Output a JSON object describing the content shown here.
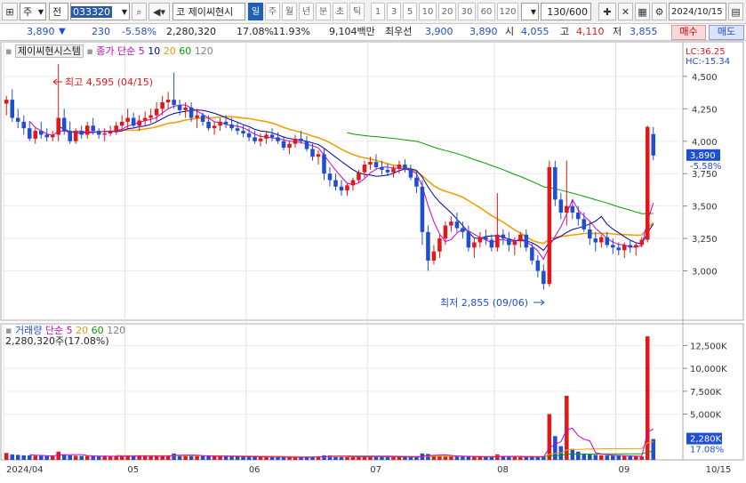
{
  "toolbar": {
    "market": "주",
    "market_type": "전",
    "code": "033320",
    "stock_name_prefix": "코",
    "stock_name": "제이씨현시",
    "periods": [
      "일",
      "주",
      "월",
      "년",
      "분",
      "초",
      "틱"
    ],
    "active_period": "일",
    "numbers": [
      "1",
      "3",
      "5",
      "10",
      "20",
      "30",
      "60",
      "120"
    ],
    "count": "130/600",
    "date": "2024/10/15",
    "icons": [
      "menu-icon",
      "dropdown-icon",
      "search-icon",
      "speaker-icon",
      "expand-icon",
      "collapse-icon",
      "grid-icon",
      "edit-icon",
      "expand-icon",
      "gear-icon"
    ]
  },
  "quote": {
    "price": "3,890",
    "direction": "▼",
    "change": "230",
    "change_pct": "-5.58%",
    "volume": "2,280,320",
    "vol_pct": "17.08%",
    "turnover": "11.93%",
    "amount": "9,104백만",
    "ask_label": "최우선",
    "ask": "3,900",
    "bid": "3,890",
    "open_label": "시",
    "open": "4,055",
    "high_label": "고",
    "high": "4,110",
    "low_label": "저",
    "low": "3,855",
    "buy_label": "매수",
    "sell_label": "매도"
  },
  "price_panel": {
    "title": "제이씨현시스템",
    "ma_label": "종가 단순",
    "ma_periods": [
      "5",
      "10",
      "20",
      "60",
      "120"
    ],
    "lc": "LC:36.25",
    "hc": "HC:-15.34",
    "high_annotation": "최고 4,595 (04/15)",
    "low_annotation": "최저 2,855 (09/06)",
    "current_price_tag": "3,890",
    "current_pct_tag": "-5.58%",
    "y_ticks": [
      "4,500",
      "4,250",
      "4,000",
      "3,750",
      "3,500",
      "3,250",
      "3,000"
    ]
  },
  "volume_panel": {
    "title": "거래량",
    "ma_label": "단순",
    "ma_periods": [
      "5",
      "20",
      "60",
      "120"
    ],
    "value": "2,280,320주(17.08%)",
    "current_tag": "2,280K",
    "current_pct_tag": "17.08%",
    "y_ticks": [
      "12,500K",
      "10,000K",
      "7,500K",
      "5,000K"
    ]
  },
  "x_axis": {
    "labels": [
      "2024/04",
      "05",
      "06",
      "07",
      "08",
      "09",
      "10",
      "10/15"
    ]
  },
  "colors": {
    "up": "#e01818",
    "down": "#1f4fd0",
    "ma5": "#cc00cc",
    "ma10": "#0000aa",
    "ma20": "#f0a000",
    "ma60": "#00a000",
    "ma120": "#808080"
  },
  "chart_data": {
    "type": "candlestick",
    "start": "2024/04/01",
    "ohlc": [
      [
        4290,
        4350,
        4200,
        4320
      ],
      [
        4320,
        4400,
        4150,
        4180
      ],
      [
        4180,
        4250,
        4100,
        4150
      ],
      [
        4150,
        4200,
        4050,
        4100
      ],
      [
        4100,
        4150,
        4000,
        4020
      ],
      [
        4020,
        4100,
        3980,
        4080
      ],
      [
        4080,
        4150,
        4020,
        4050
      ],
      [
        4050,
        4100,
        4000,
        4030
      ],
      [
        4030,
        4080,
        4000,
        4050
      ],
      [
        4050,
        4595,
        4000,
        4180
      ],
      [
        4180,
        4250,
        4050,
        4080
      ],
      [
        4080,
        4150,
        3980,
        4000
      ],
      [
        4000,
        4100,
        3980,
        4080
      ],
      [
        4080,
        4120,
        4020,
        4050
      ],
      [
        4050,
        4150,
        4020,
        4120
      ],
      [
        4120,
        4180,
        4050,
        4080
      ],
      [
        4080,
        4100,
        4020,
        4050
      ],
      [
        4050,
        4100,
        4000,
        4060
      ],
      [
        4060,
        4120,
        4040,
        4080
      ],
      [
        4080,
        4150,
        4050,
        4120
      ],
      [
        4120,
        4200,
        4080,
        4150
      ],
      [
        4150,
        4250,
        4100,
        4180
      ],
      [
        4180,
        4220,
        4100,
        4120
      ],
      [
        4120,
        4200,
        4080,
        4160
      ],
      [
        4160,
        4230,
        4120,
        4180
      ],
      [
        4180,
        4250,
        4140,
        4200
      ],
      [
        4200,
        4300,
        4150,
        4250
      ],
      [
        4250,
        4350,
        4200,
        4300
      ],
      [
        4300,
        4380,
        4250,
        4320
      ],
      [
        4320,
        4530,
        4250,
        4280
      ],
      [
        4280,
        4320,
        4200,
        4240
      ],
      [
        4240,
        4300,
        4180,
        4260
      ],
      [
        4260,
        4300,
        4150,
        4180
      ],
      [
        4180,
        4250,
        4100,
        4200
      ],
      [
        4200,
        4220,
        4120,
        4150
      ],
      [
        4150,
        4200,
        4080,
        4100
      ],
      [
        4100,
        4150,
        4050,
        4120
      ],
      [
        4120,
        4180,
        4080,
        4150
      ],
      [
        4150,
        4200,
        4100,
        4130
      ],
      [
        4130,
        4180,
        4080,
        4100
      ],
      [
        4100,
        4150,
        4050,
        4080
      ],
      [
        4080,
        4130,
        4030,
        4060
      ],
      [
        4060,
        4100,
        4000,
        4030
      ],
      [
        4030,
        4080,
        3980,
        4000
      ],
      [
        4000,
        4060,
        3960,
        4020
      ],
      [
        4020,
        4080,
        3980,
        4050
      ],
      [
        4050,
        4100,
        4000,
        4030
      ],
      [
        4030,
        4070,
        3980,
        4000
      ],
      [
        4000,
        4040,
        3930,
        3950
      ],
      [
        3950,
        4000,
        3900,
        3980
      ],
      [
        3980,
        4050,
        3950,
        4020
      ],
      [
        4020,
        4080,
        3980,
        4000
      ],
      [
        4000,
        4040,
        3920,
        3940
      ],
      [
        3940,
        3980,
        3850,
        3880
      ],
      [
        3880,
        3930,
        3820,
        3900
      ],
      [
        3900,
        3950,
        3700,
        3750
      ],
      [
        3750,
        3800,
        3650,
        3700
      ],
      [
        3700,
        3750,
        3620,
        3650
      ],
      [
        3650,
        3700,
        3580,
        3620
      ],
      [
        3620,
        3680,
        3580,
        3660
      ],
      [
        3660,
        3720,
        3620,
        3700
      ],
      [
        3700,
        3780,
        3680,
        3760
      ],
      [
        3760,
        3850,
        3720,
        3820
      ],
      [
        3820,
        3880,
        3780,
        3840
      ],
      [
        3840,
        3900,
        3780,
        3800
      ],
      [
        3800,
        3850,
        3740,
        3780
      ],
      [
        3780,
        3830,
        3730,
        3760
      ],
      [
        3760,
        3810,
        3720,
        3790
      ],
      [
        3790,
        3850,
        3750,
        3820
      ],
      [
        3820,
        3860,
        3760,
        3780
      ],
      [
        3780,
        3820,
        3700,
        3720
      ],
      [
        3720,
        3780,
        3600,
        3650
      ],
      [
        3650,
        3700,
        3200,
        3300
      ],
      [
        3300,
        3350,
        3000,
        3080
      ],
      [
        3080,
        3200,
        3050,
        3150
      ],
      [
        3150,
        3280,
        3100,
        3250
      ],
      [
        3250,
        3380,
        3200,
        3350
      ],
      [
        3350,
        3420,
        3300,
        3380
      ],
      [
        3380,
        3450,
        3300,
        3330
      ],
      [
        3330,
        3380,
        3250,
        3300
      ],
      [
        3300,
        3350,
        3150,
        3180
      ],
      [
        3180,
        3250,
        3100,
        3220
      ],
      [
        3220,
        3300,
        3180,
        3260
      ],
      [
        3260,
        3320,
        3200,
        3240
      ],
      [
        3240,
        3280,
        3150,
        3180
      ],
      [
        3180,
        3600,
        3150,
        3280
      ],
      [
        3280,
        3320,
        3200,
        3250
      ],
      [
        3250,
        3300,
        3150,
        3200
      ],
      [
        3200,
        3260,
        3120,
        3230
      ],
      [
        3230,
        3300,
        3180,
        3280
      ],
      [
        3280,
        3320,
        3150,
        3180
      ],
      [
        3180,
        3220,
        3050,
        3080
      ],
      [
        3080,
        3120,
        2950,
        3000
      ],
      [
        3000,
        3050,
        2855,
        2900
      ],
      [
        2900,
        3850,
        2880,
        3800
      ],
      [
        3800,
        3850,
        3500,
        3550
      ],
      [
        3550,
        3600,
        3400,
        3450
      ],
      [
        3450,
        3850,
        3350,
        3500
      ],
      [
        3500,
        3550,
        3400,
        3450
      ],
      [
        3450,
        3500,
        3350,
        3400
      ],
      [
        3400,
        3450,
        3300,
        3320
      ],
      [
        3320,
        3380,
        3200,
        3250
      ],
      [
        3250,
        3300,
        3150,
        3220
      ],
      [
        3220,
        3280,
        3180,
        3260
      ],
      [
        3260,
        3300,
        3180,
        3200
      ],
      [
        3200,
        3250,
        3130,
        3180
      ],
      [
        3180,
        3220,
        3120,
        3160
      ],
      [
        3160,
        3220,
        3100,
        3200
      ],
      [
        3200,
        3240,
        3140,
        3180
      ],
      [
        3180,
        3220,
        3120,
        3200
      ],
      [
        3200,
        3260,
        3180,
        3240
      ],
      [
        3240,
        4120,
        3220,
        4110
      ],
      [
        4055,
        4110,
        3855,
        3890
      ]
    ],
    "volume_k": [
      750,
      600,
      550,
      500,
      480,
      450,
      430,
      420,
      410,
      900,
      600,
      500,
      450,
      430,
      420,
      410,
      400,
      390,
      380,
      400,
      420,
      450,
      430,
      420,
      410,
      400,
      420,
      450,
      480,
      700,
      520,
      470,
      450,
      430,
      420,
      410,
      400,
      390,
      380,
      370,
      360,
      350,
      340,
      330,
      320,
      310,
      300,
      290,
      280,
      270,
      280,
      300,
      310,
      320,
      330,
      500,
      480,
      400,
      360,
      340,
      330,
      350,
      380,
      420,
      380,
      360,
      340,
      330,
      320,
      310,
      300,
      320,
      700,
      650,
      500,
      450,
      420,
      400,
      380,
      360,
      340,
      320,
      310,
      300,
      290,
      600,
      350,
      330,
      320,
      310,
      300,
      320,
      350,
      400,
      5000,
      2600,
      1500,
      7000,
      1200,
      900,
      700,
      600,
      550,
      500,
      480,
      460,
      440,
      420,
      400,
      380,
      370,
      13500,
      2280
    ],
    "price_axis_range": [
      2750,
      4650
    ],
    "volume_axis_range": [
      0,
      14000
    ],
    "ma_periods": [
      5,
      10,
      20,
      60,
      120
    ]
  }
}
